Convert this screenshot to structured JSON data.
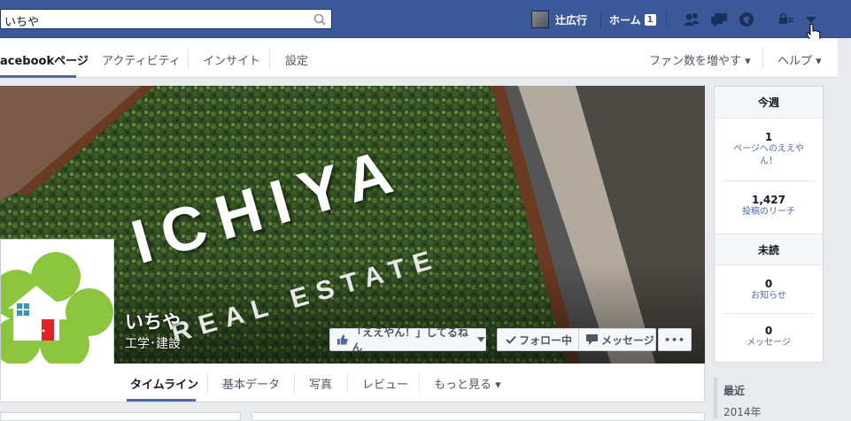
{
  "topbar": {
    "search_value": "いちや",
    "profile_name": "辻広行",
    "home_label": "ホーム",
    "home_count": "1",
    "icons": [
      "friends-icon",
      "messages-icon",
      "notifications-icon",
      "privacy-icon",
      "account-menu-icon"
    ],
    "brand_color": "#3b5998"
  },
  "nav": {
    "tabs": [
      "acebookページ",
      "アクティビティ",
      "インサイト",
      "設定"
    ],
    "right": [
      "ファン数を増やす ▾",
      "ヘルプ ▾"
    ]
  },
  "page": {
    "name": "いちや",
    "category": "工学･建設",
    "cover_text_1": "ICHIYA",
    "cover_text_2": "REAL ESTATE",
    "like_button": "「ええやん！」してるねん",
    "follow_button": "フォロー中",
    "message_button": "メッセージ",
    "more_button": "•••",
    "tabs": [
      "タイムライン",
      "基本データ",
      "写真",
      "レビュー",
      "もっと見る ▾"
    ]
  },
  "sidebar": {
    "week_header": "今週",
    "likes_num": "1",
    "likes_label": "ページへのええや ん！",
    "reach_num": "1,427",
    "reach_label": "投稿のリーチ",
    "unread_header": "未読",
    "notif_num": "0",
    "notif_label": "お知らせ",
    "msg_num": "0",
    "msg_label": "メッセージ"
  },
  "timeline": {
    "recent": "最近",
    "year": "2014年"
  }
}
